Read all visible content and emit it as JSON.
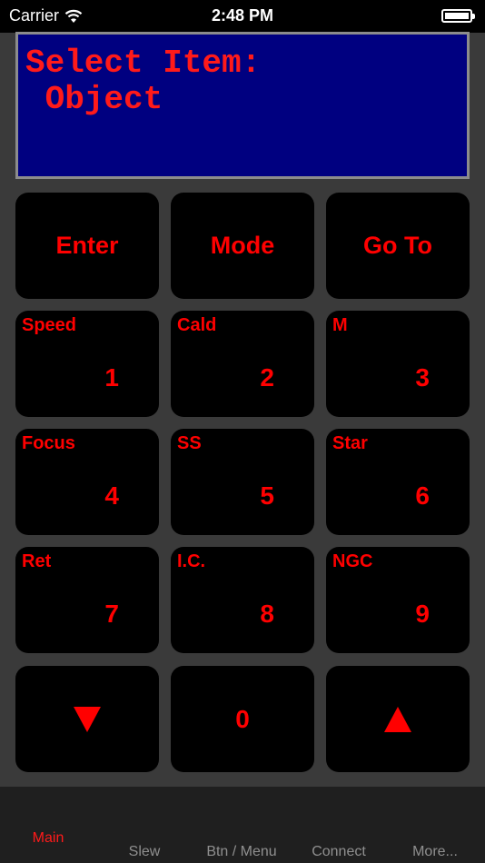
{
  "status_bar": {
    "carrier": "Carrier",
    "time": "2:48 PM"
  },
  "display": {
    "line1": "Select Item:",
    "line2": " Object"
  },
  "top_keys": [
    {
      "label": "Enter"
    },
    {
      "label": "Mode"
    },
    {
      "label": "Go To"
    }
  ],
  "number_keys": [
    {
      "label": "Speed",
      "digit": "1"
    },
    {
      "label": "Cald",
      "digit": "2"
    },
    {
      "label": "M",
      "digit": "3"
    },
    {
      "label": "Focus",
      "digit": "4"
    },
    {
      "label": "SS",
      "digit": "5"
    },
    {
      "label": "Star",
      "digit": "6"
    },
    {
      "label": "Ret",
      "digit": "7"
    },
    {
      "label": "I.C.",
      "digit": "8"
    },
    {
      "label": "NGC",
      "digit": "9"
    }
  ],
  "bottom_keys": {
    "down_icon": "triangle-down-icon",
    "zero": "0",
    "up_icon": "triangle-up-icon"
  },
  "tabs": [
    {
      "label": "Main",
      "active": true
    },
    {
      "label": "Slew"
    },
    {
      "label": "Btn / Menu"
    },
    {
      "label": "Connect"
    },
    {
      "label": "More..."
    }
  ],
  "colors": {
    "accent": "#ff0000",
    "display_bg": "#000080",
    "background": "#3a3a3a"
  }
}
